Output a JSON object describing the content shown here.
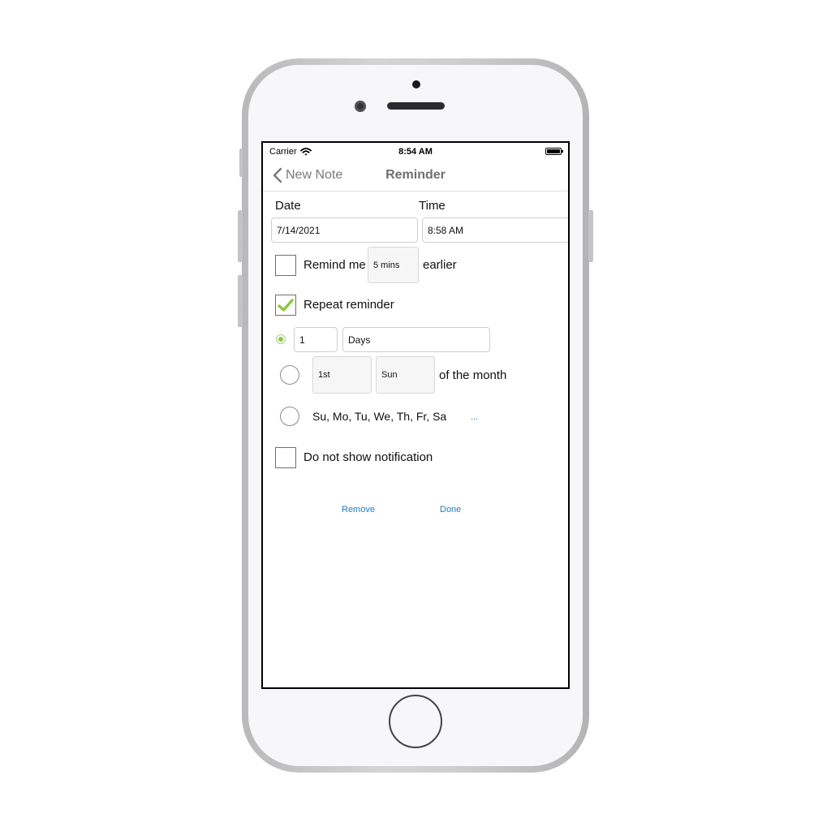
{
  "status_bar": {
    "carrier": "Carrier",
    "time": "8:54 AM"
  },
  "nav": {
    "back_label": "New Note",
    "title": "Reminder"
  },
  "date": {
    "label": "Date",
    "value": "7/14/2021"
  },
  "time": {
    "label": "Time",
    "value": "8:58 AM"
  },
  "remind_me": {
    "checked": false,
    "prefix": "Remind me",
    "offset": "5 mins",
    "suffix": "earlier"
  },
  "repeat": {
    "checked": true,
    "label": "Repeat reminder"
  },
  "interval_option": {
    "selected": true,
    "count": "1",
    "unit": "Days"
  },
  "monthly_option": {
    "selected": false,
    "ordinal": "1st",
    "weekday": "Sun",
    "suffix": "of the month"
  },
  "weekly_option": {
    "selected": false,
    "days": "Su, Mo, Tu, We, Th, Fr, Sa",
    "more": "..."
  },
  "no_notification": {
    "checked": false,
    "label": "Do not show notification"
  },
  "actions": {
    "remove": "Remove",
    "done": "Done"
  },
  "colors": {
    "accent_blue": "#1a7fd1",
    "check_green": "#8cc63f"
  }
}
